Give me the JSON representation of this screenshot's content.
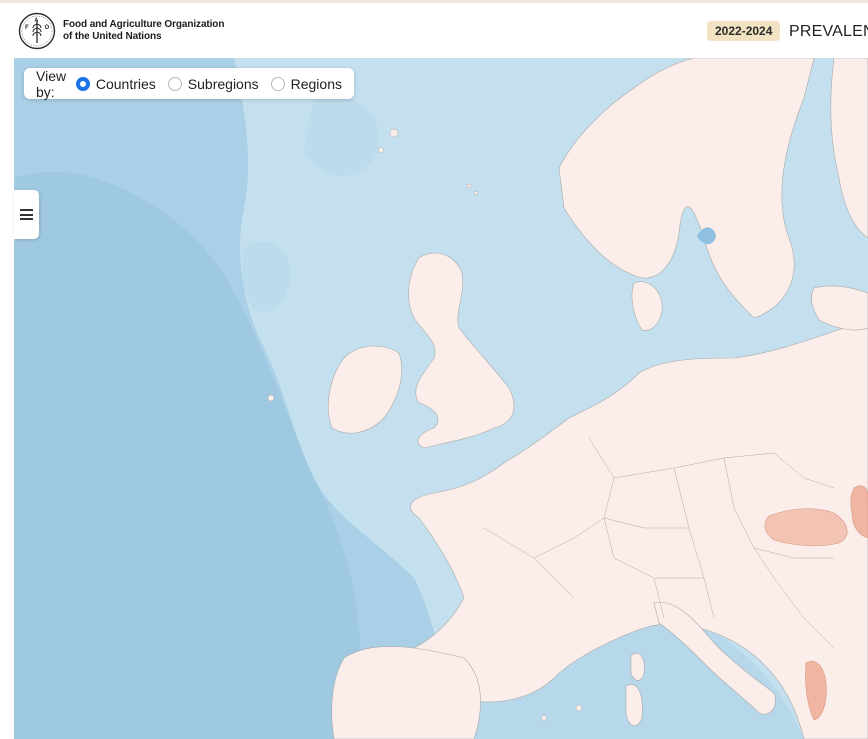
{
  "header": {
    "org_line1": "Food and Agriculture Organization",
    "org_line2": "of the United Nations",
    "logo_letters": [
      "F",
      "A",
      "O"
    ],
    "period": "2022-2024",
    "indicator_title": "PREVALENCE"
  },
  "view_by": {
    "label": "View by:",
    "options": [
      {
        "label": "Countries",
        "checked": true
      },
      {
        "label": "Subregions",
        "checked": false
      },
      {
        "label": "Regions",
        "checked": false
      }
    ]
  },
  "menu": {
    "icon": "hamburger-menu-icon"
  },
  "colors": {
    "ocean": "#aed3e8",
    "ocean_shelf": "#cde5f1",
    "land": "#fbeeea",
    "highlight": "#f3c3b3",
    "highlight_strong": "#f0b6a2",
    "accent": "#1a73e8",
    "badge": "#f1e2c2"
  }
}
